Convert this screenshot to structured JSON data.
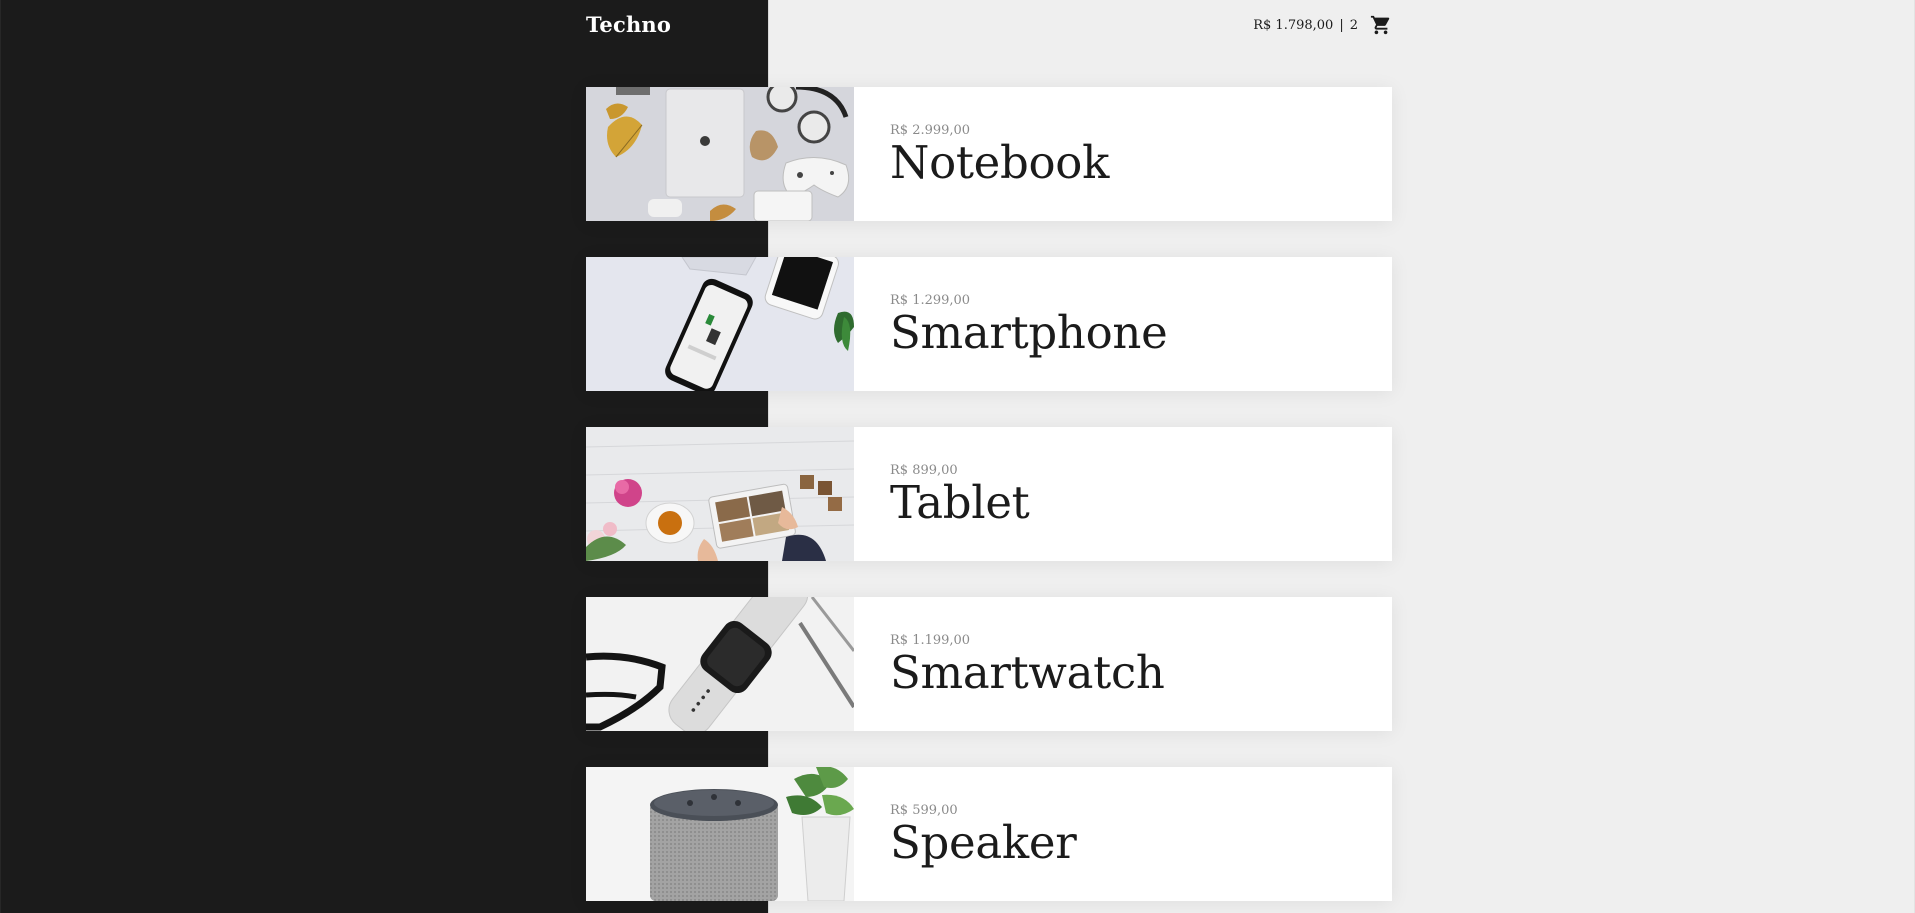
{
  "header": {
    "logo": "Techno",
    "cart_total": "R$ 1.798,00",
    "cart_separator": "|",
    "cart_count": "2",
    "cart_icon": "cart-icon"
  },
  "products": [
    {
      "price": "R$ 2.999,00",
      "name": "Notebook",
      "image": "notebook-photo"
    },
    {
      "price": "R$ 1.299,00",
      "name": "Smartphone",
      "image": "smartphone-photo"
    },
    {
      "price": "R$ 899,00",
      "name": "Tablet",
      "image": "tablet-photo"
    },
    {
      "price": "R$ 1.199,00",
      "name": "Smartwatch",
      "image": "smartwatch-photo"
    },
    {
      "price": "R$ 599,00",
      "name": "Speaker",
      "image": "speaker-photo"
    }
  ],
  "colors": {
    "sidebar": "#1b1b1b",
    "background": "#efefef",
    "card": "#ffffff",
    "price": "#8a8a8a",
    "text": "#1b1b1b"
  }
}
